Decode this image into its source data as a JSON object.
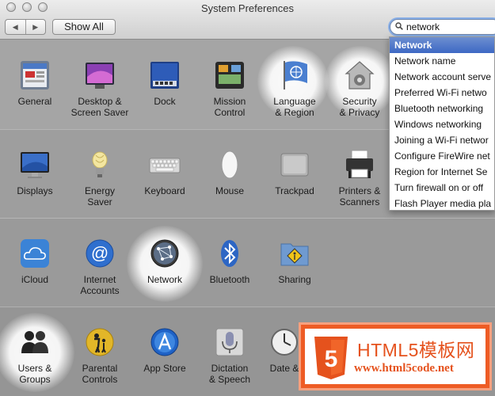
{
  "window": {
    "title": "System Preferences"
  },
  "toolbar": {
    "back_glyph": "◀",
    "forward_glyph": "▶",
    "show_all_label": "Show All"
  },
  "search": {
    "value": "network"
  },
  "rows": [
    [
      {
        "label": "General",
        "icon": "general-icon"
      },
      {
        "label": "Desktop &\nScreen Saver",
        "icon": "desktop-screensaver-icon"
      },
      {
        "label": "Dock",
        "icon": "dock-icon"
      },
      {
        "label": "Mission\nControl",
        "icon": "mission-control-icon"
      },
      {
        "label": "Language\n& Region",
        "icon": "language-region-icon"
      },
      {
        "label": "Security\n& Privacy",
        "icon": "security-privacy-icon"
      }
    ],
    [
      {
        "label": "Displays",
        "icon": "displays-icon"
      },
      {
        "label": "Energy\nSaver",
        "icon": "energy-saver-icon"
      },
      {
        "label": "Keyboard",
        "icon": "keyboard-icon"
      },
      {
        "label": "Mouse",
        "icon": "mouse-icon"
      },
      {
        "label": "Trackpad",
        "icon": "trackpad-icon"
      },
      {
        "label": "Printers &\nScanners",
        "icon": "printers-scanners-icon"
      }
    ],
    [
      {
        "label": "iCloud",
        "icon": "icloud-icon"
      },
      {
        "label": "Internet\nAccounts",
        "icon": "internet-accounts-icon"
      },
      {
        "label": "Network",
        "icon": "network-icon"
      },
      {
        "label": "Bluetooth",
        "icon": "bluetooth-icon"
      },
      {
        "label": "Sharing",
        "icon": "sharing-icon"
      }
    ],
    [
      {
        "label": "Users &\nGroups",
        "icon": "users-groups-icon"
      },
      {
        "label": "Parental\nControls",
        "icon": "parental-controls-icon"
      },
      {
        "label": "App Store",
        "icon": "app-store-icon"
      },
      {
        "label": "Dictation\n& Speech",
        "icon": "dictation-speech-icon"
      },
      {
        "label": "Date &",
        "icon": "date-time-icon"
      }
    ]
  ],
  "dropdown": {
    "header": "Network",
    "items": [
      "Network name",
      "Network account serve",
      "Preferred Wi-Fi netwo",
      "Bluetooth networking",
      "Windows networking",
      "Joining a Wi-Fi networ",
      "Configure FireWire net",
      "Region for Internet Se",
      "Turn firewall on or off",
      "Flash Player media pla"
    ]
  },
  "watermark": {
    "title": "HTML5模板网",
    "url": "www.html5code.net",
    "shield_glyph": "5"
  },
  "colors": {
    "selection": "#3d68c4",
    "watermark": "#ee5c25"
  }
}
